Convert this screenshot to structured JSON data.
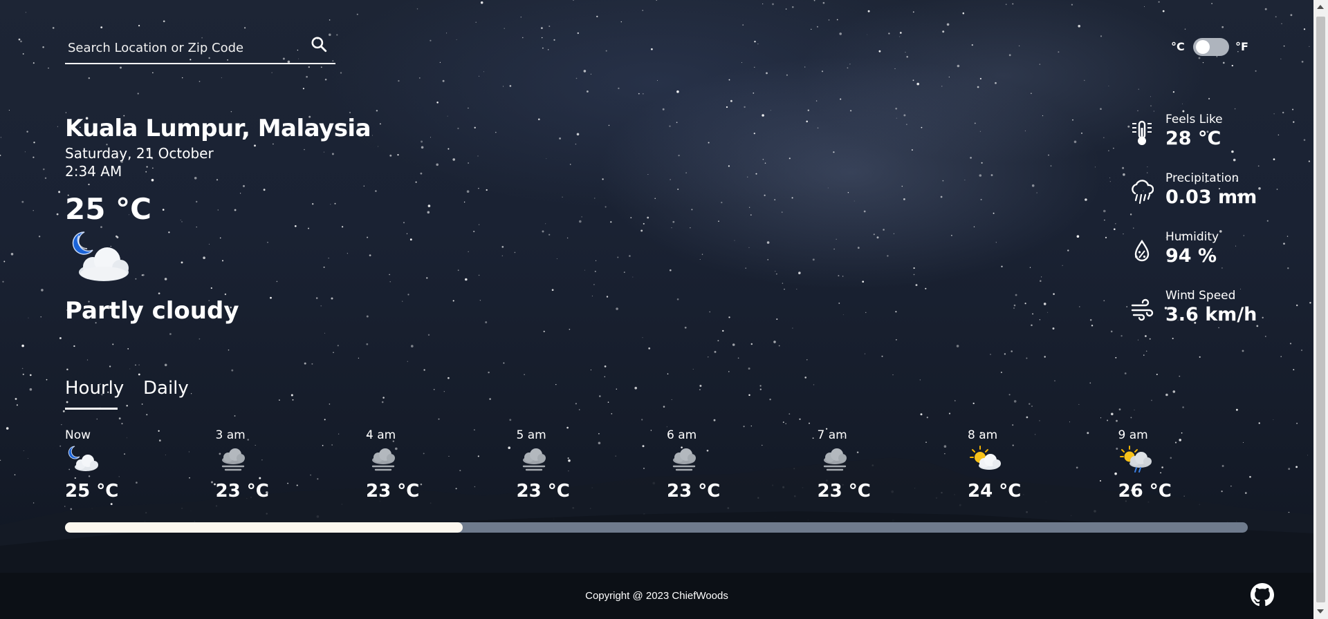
{
  "search": {
    "placeholder": "Search Location or Zip Code",
    "value": ""
  },
  "units": {
    "celsius_label": "°C",
    "fahrenheit_label": "°F",
    "selected": "°C"
  },
  "location": {
    "city": "Kuala Lumpur, Malaysia",
    "date": "Saturday, 21 October",
    "time": "2:34 AM"
  },
  "current": {
    "temperature": "25 °C",
    "condition": "Partly cloudy",
    "icon": "moon-cloud-icon"
  },
  "stats": {
    "feels_like": {
      "label": "Feels Like",
      "value": "28 °C",
      "icon": "thermometer-icon"
    },
    "precipitation": {
      "label": "Precipitation",
      "value": "0.03 mm",
      "icon": "rain-cloud-icon"
    },
    "humidity": {
      "label": "Humidity",
      "value": "94 %",
      "icon": "water-drop-icon"
    },
    "wind_speed": {
      "label": "Wind Speed",
      "value": "3.6 km/h",
      "icon": "wind-icon"
    }
  },
  "tabs": {
    "hourly": "Hourly",
    "daily": "Daily",
    "active": "Hourly"
  },
  "hourly": [
    {
      "time": "Now",
      "temp": "25 °C",
      "icon": "moon-cloud-icon"
    },
    {
      "time": "3 am",
      "temp": "23 °C",
      "icon": "fog-cloud-icon"
    },
    {
      "time": "4 am",
      "temp": "23 °C",
      "icon": "fog-cloud-icon"
    },
    {
      "time": "5 am",
      "temp": "23 °C",
      "icon": "fog-cloud-icon"
    },
    {
      "time": "6 am",
      "temp": "23 °C",
      "icon": "fog-cloud-icon"
    },
    {
      "time": "7 am",
      "temp": "23 °C",
      "icon": "fog-cloud-icon"
    },
    {
      "time": "8 am",
      "temp": "24 °C",
      "icon": "sun-cloud-icon"
    },
    {
      "time": "9 am",
      "temp": "26 °C",
      "icon": "sun-rain-cloud-icon"
    }
  ],
  "forecast_scroll": {
    "position_fraction": 0
  },
  "footer": {
    "copyright": "Copyright @ 2023 ChiefWoods",
    "github_icon": "github-icon"
  },
  "colors": {
    "background_top": "#1d2535",
    "footer": "#0c1016",
    "scrollbar_track": "#6f7b8d",
    "scrollbar_thumb": "#fbf7ef",
    "text": "#ffffff"
  }
}
